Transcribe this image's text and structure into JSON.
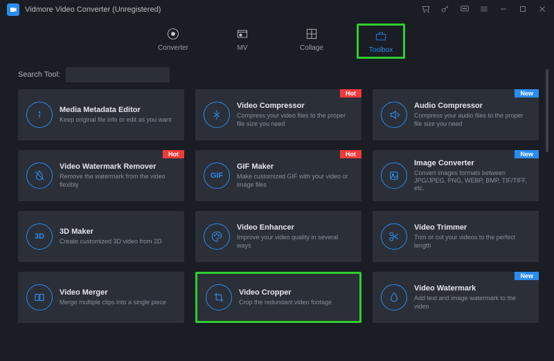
{
  "app": {
    "title": "Vidmore Video Converter (Unregistered)"
  },
  "tabs": [
    {
      "label": "Converter"
    },
    {
      "label": "MV"
    },
    {
      "label": "Collage"
    },
    {
      "label": "Toolbox"
    }
  ],
  "search": {
    "label": "Search Tool:",
    "value": ""
  },
  "badges": {
    "hot": "Hot",
    "new": "New"
  },
  "tools": [
    {
      "title": "Media Metadata Editor",
      "desc": "Keep original file info or edit as you want",
      "badge": ""
    },
    {
      "title": "Video Compressor",
      "desc": "Compress your video files to the proper file size you need",
      "badge": "hot"
    },
    {
      "title": "Audio Compressor",
      "desc": "Compress your audio files to the proper file size you need",
      "badge": "new"
    },
    {
      "title": "Video Watermark Remover",
      "desc": "Remove the watermark from the video flexibly",
      "badge": "hot"
    },
    {
      "title": "GIF Maker",
      "desc": "Make customized GIF with your video or image files",
      "badge": "hot"
    },
    {
      "title": "Image Converter",
      "desc": "Convert images formats between JPG/JPEG, PNG, WEBP, BMP, TIF/TIFF, etc.",
      "badge": "new"
    },
    {
      "title": "3D Maker",
      "desc": "Create customized 3D video from 2D",
      "badge": ""
    },
    {
      "title": "Video Enhancer",
      "desc": "Improve your video quality in several ways",
      "badge": ""
    },
    {
      "title": "Video Trimmer",
      "desc": "Trim or cut your videos to the perfect length",
      "badge": ""
    },
    {
      "title": "Video Merger",
      "desc": "Merge multiple clips into a single piece",
      "badge": ""
    },
    {
      "title": "Video Cropper",
      "desc": "Crop the redundant video footage",
      "badge": ""
    },
    {
      "title": "Video Watermark",
      "desc": "Add text and image watermark to the video",
      "badge": "new"
    }
  ]
}
